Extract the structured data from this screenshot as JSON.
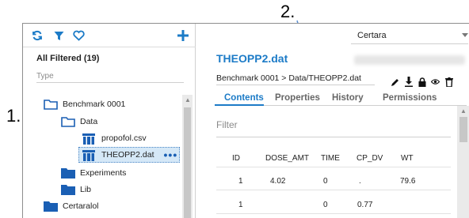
{
  "callouts": {
    "one": "1.",
    "two": "2."
  },
  "left_panel": {
    "filter_title": "All Filtered (19)",
    "type_placeholder": "Type",
    "tree": [
      {
        "label": "Benchmark 0001",
        "kind": "folder-outline"
      },
      {
        "label": "Data",
        "kind": "folder-outline"
      },
      {
        "label": "propofol.csv",
        "kind": "dataset"
      },
      {
        "label": "THEOPP2.dat",
        "kind": "dataset",
        "selected": true,
        "menu": "•••"
      },
      {
        "label": "Experiments",
        "kind": "folder"
      },
      {
        "label": "Lib",
        "kind": "folder"
      },
      {
        "label": "Certaralol",
        "kind": "folder"
      }
    ]
  },
  "right_panel": {
    "project_select": "Certara",
    "file_title": "THEOPP2.dat",
    "breadcrumb": "Benchmark 0001 > Data/THEOPP2.dat",
    "tabs": [
      "Contents",
      "Properties",
      "History",
      "Permissions"
    ],
    "active_tab": "Contents",
    "filter_placeholder": "Filter",
    "table": {
      "columns": [
        "ID",
        "DOSE_AMT",
        "TIME",
        "CP_DV",
        "WT"
      ],
      "rows": [
        [
          "1",
          "4.02",
          "0",
          ".",
          "79.6"
        ],
        [
          "1",
          "",
          "0",
          "0.77",
          ""
        ]
      ]
    }
  },
  "colors": {
    "accent": "#1c7bc7",
    "selected_bg": "#d5e8f7"
  }
}
